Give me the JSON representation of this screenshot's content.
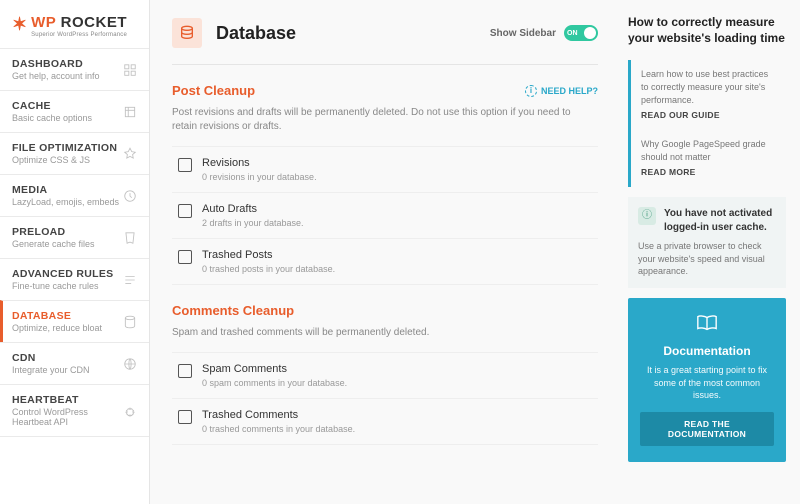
{
  "brand": {
    "wp": "WP",
    "rocket": "ROCKET",
    "tagline": "Superior WordPress Performance"
  },
  "nav": [
    {
      "title": "DASHBOARD",
      "desc": "Get help, account info"
    },
    {
      "title": "CACHE",
      "desc": "Basic cache options"
    },
    {
      "title": "FILE OPTIMIZATION",
      "desc": "Optimize CSS & JS"
    },
    {
      "title": "MEDIA",
      "desc": "LazyLoad, emojis, embeds"
    },
    {
      "title": "PRELOAD",
      "desc": "Generate cache files"
    },
    {
      "title": "ADVANCED RULES",
      "desc": "Fine-tune cache rules"
    },
    {
      "title": "DATABASE",
      "desc": "Optimize, reduce bloat"
    },
    {
      "title": "CDN",
      "desc": "Integrate your CDN"
    },
    {
      "title": "HEARTBEAT",
      "desc": "Control WordPress Heartbeat API"
    }
  ],
  "header": {
    "title": "Database",
    "toggle_label": "Show Sidebar",
    "toggle_state": "ON"
  },
  "help": "NEED HELP?",
  "sections": [
    {
      "title": "Post Cleanup",
      "desc": "Post revisions and drafts will be permanently deleted. Do not use this option if you need to retain revisions or drafts.",
      "opts": [
        {
          "title": "Revisions",
          "sub": "0 revisions in your database."
        },
        {
          "title": "Auto Drafts",
          "sub": "2 drafts in your database."
        },
        {
          "title": "Trashed Posts",
          "sub": "0 trashed posts in your database."
        }
      ]
    },
    {
      "title": "Comments Cleanup",
      "desc": "Spam and trashed comments will be permanently deleted.",
      "opts": [
        {
          "title": "Spam Comments",
          "sub": "0 spam comments in your database."
        },
        {
          "title": "Trashed Comments",
          "sub": "0 trashed comments in your database."
        }
      ]
    }
  ],
  "right": {
    "title": "How to correctly measure your website's loading time",
    "cards": [
      {
        "text": "Learn how to use best practices to correctly measure your site's performance.",
        "link": "READ OUR GUIDE"
      },
      {
        "text": "Why Google PageSpeed grade should not matter",
        "link": "READ MORE"
      }
    ],
    "info": {
      "title": "You have not activated logged-in user cache.",
      "text": "Use a private browser to check your website's speed and visual appearance."
    },
    "doc": {
      "title": "Documentation",
      "text": "It is a great starting point to fix some of the most common issues.",
      "btn": "READ THE DOCUMENTATION"
    }
  }
}
